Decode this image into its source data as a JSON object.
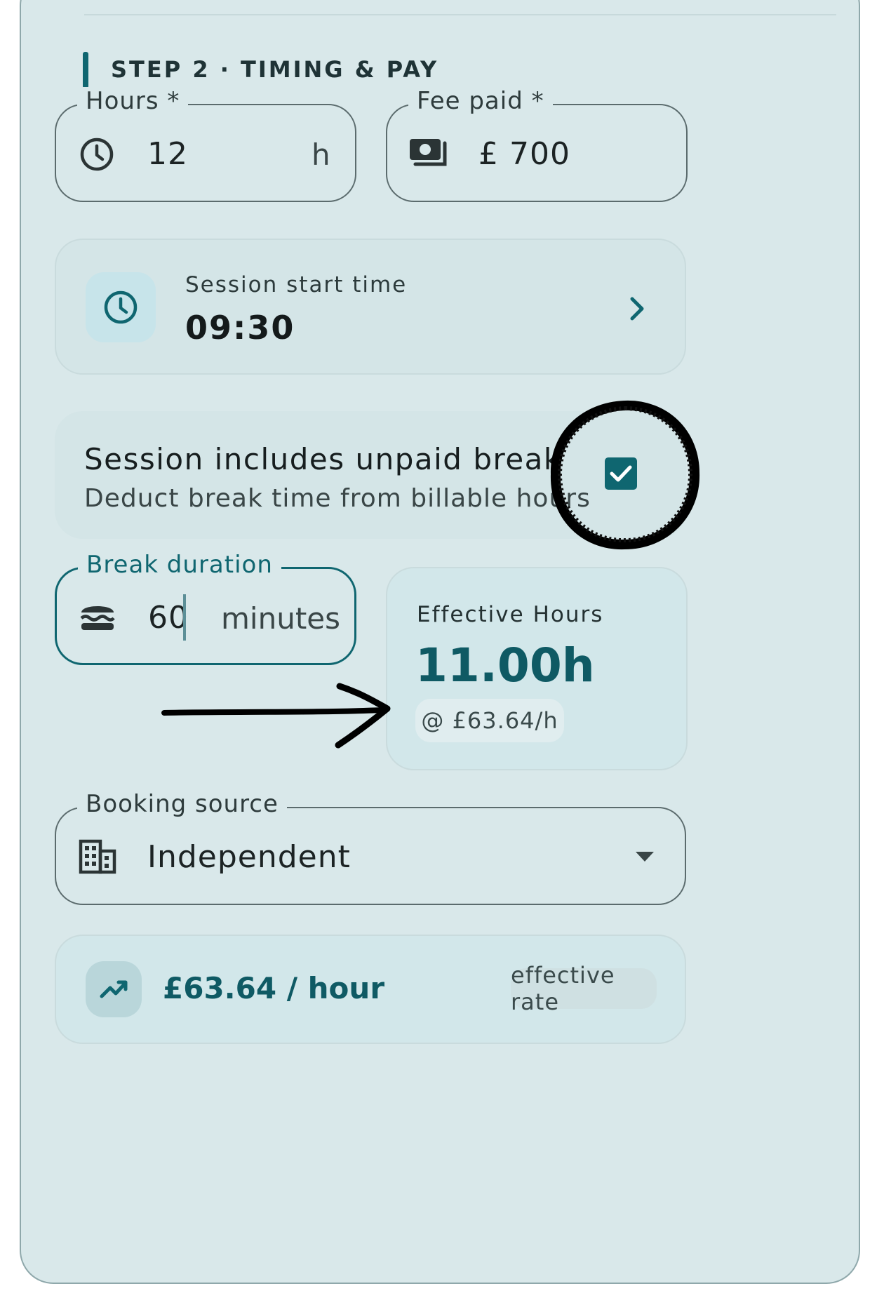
{
  "step": {
    "title": "STEP 2 · TIMING & PAY"
  },
  "hours": {
    "label": "Hours *",
    "value": "12",
    "suffix": "h",
    "icon": "clock-icon"
  },
  "fee": {
    "label": "Fee paid *",
    "value": "£ 700",
    "icon": "money-icon"
  },
  "session_start": {
    "label": "Session start time",
    "value": "09:30",
    "icon": "clock-icon",
    "action_icon": "chevron-right-icon"
  },
  "unpaid_break": {
    "title": "Session includes unpaid break",
    "subtitle": "Deduct break time from billable hours",
    "checked": true
  },
  "break_duration": {
    "label": "Break duration",
    "value": "60",
    "suffix": "minutes",
    "icon": "burger-icon"
  },
  "effective_hours": {
    "label": "Effective Hours",
    "value": "11.00h",
    "rate_chip": "@ £63.64/h"
  },
  "booking_source": {
    "label": "Booking source",
    "value": "Independent",
    "icon": "building-icon",
    "dropdown_icon": "caret-down-icon"
  },
  "rate_summary": {
    "value": "£63.64 / hour",
    "chip": "effective rate",
    "icon": "trending-up-icon"
  },
  "colors": {
    "accent": "#0f6670",
    "card_bg": "#d9e8ea",
    "tile_bg": "#c8e3e8"
  }
}
